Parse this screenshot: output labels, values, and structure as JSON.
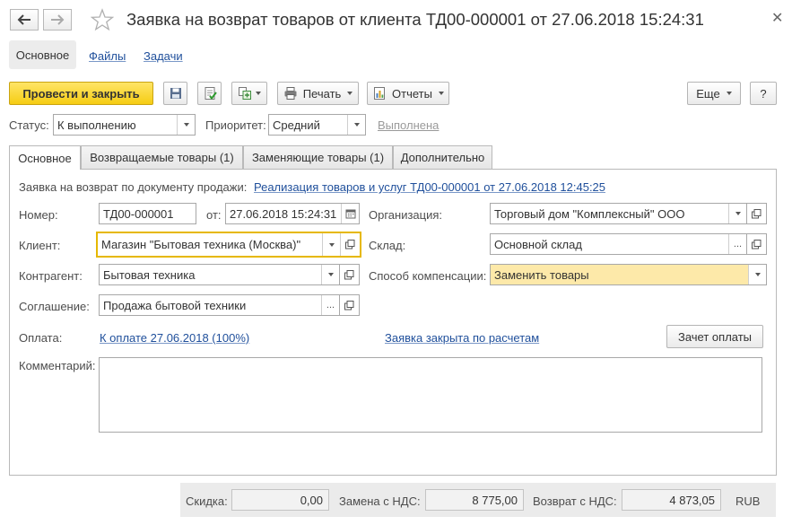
{
  "window": {
    "title": "Заявка на возврат товаров от клиента ТД00-000001 от 27.06.2018 15:24:31"
  },
  "form_tabs": [
    {
      "label": "Основное"
    },
    {
      "label": "Файлы"
    },
    {
      "label": "Задачи"
    }
  ],
  "toolbar": {
    "post_close_label": "Провести и закрыть",
    "print_label": "Печать",
    "reports_label": "Отчеты",
    "more_label": "Еще",
    "help_label": "?"
  },
  "status_row": {
    "status_label": "Статус:",
    "status_value": "К выполнению",
    "priority_label": "Приоритет:",
    "priority_value": "Средний",
    "done_link": "Выполнена"
  },
  "page_tabs": [
    {
      "label": "Основное"
    },
    {
      "label": "Возвращаемые товары (1)"
    },
    {
      "label": "Заменяющие товары (1)"
    },
    {
      "label": "Дополнительно"
    }
  ],
  "main": {
    "sale_doc_label": "Заявка на возврат по документу продажи:",
    "sale_doc_link": "Реализация товаров и услуг ТД00-000001 от 27.06.2018 12:45:25",
    "number_label": "Номер:",
    "number_value": "ТД00-000001",
    "date_label": "от:",
    "date_value": "27.06.2018 15:24:31",
    "org_label": "Организация:",
    "org_value": "Торговый дом \"Комплексный\" ООО",
    "client_label": "Клиент:",
    "client_value": "Магазин \"Бытовая техника (Москва)\"",
    "warehouse_label": "Склад:",
    "warehouse_value": "Основной склад",
    "counterparty_label": "Контрагент:",
    "counterparty_value": "Бытовая техника",
    "compensation_label": "Способ компенсации:",
    "compensation_value": "Заменить товары",
    "agreement_label": "Соглашение:",
    "agreement_value": "Продажа бытовой техники",
    "payment_label": "Оплата:",
    "payment_link": "К оплате 27.06.2018 (100%)",
    "closed_link": "Заявка закрыта по расчетам",
    "offset_button": "Зачет оплаты",
    "comment_label": "Комментарий:",
    "comment_value": ""
  },
  "footer": {
    "discount_label": "Скидка:",
    "discount_value": "0,00",
    "replace_label": "Замена с НДС:",
    "replace_value": "8 775,00",
    "return_label": "Возврат с НДС:",
    "return_value": "4 873,05",
    "currency": "RUB"
  },
  "colors": {
    "accent_yellow": "#f5cc13",
    "link_blue": "#1f4f9b",
    "focus_border": "#e6b800",
    "highlight_field": "#fde9a9"
  },
  "icons": [
    "back-arrow-icon",
    "forward-arrow-icon",
    "star-icon",
    "close-icon",
    "save-icon",
    "post-icon",
    "create-based-icon",
    "print-icon",
    "reports-icon",
    "dropdown-icon",
    "open-icon",
    "calendar-icon",
    "select-dots-icon"
  ]
}
